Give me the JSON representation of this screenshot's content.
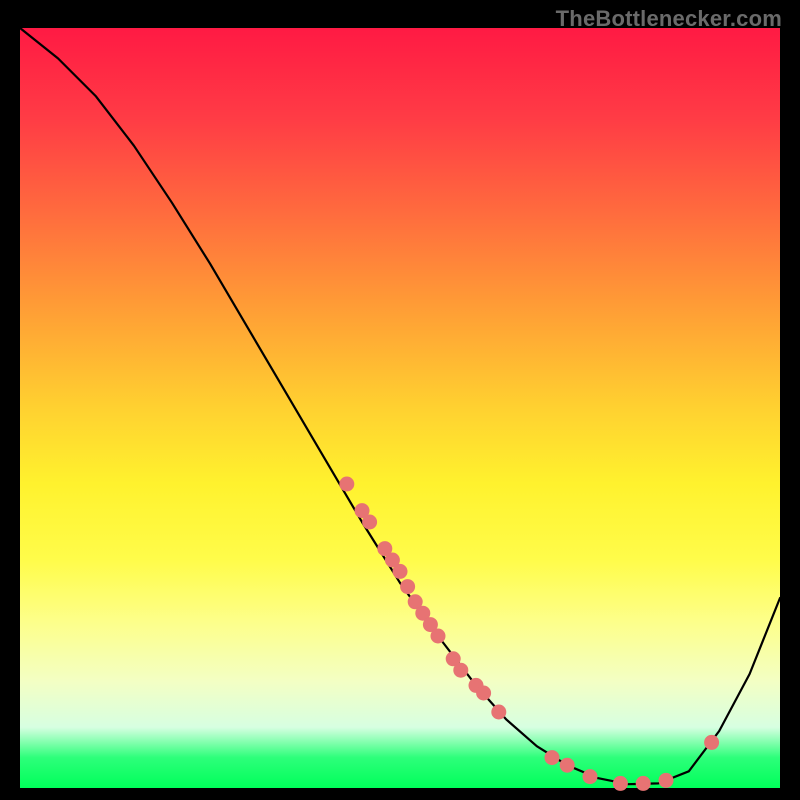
{
  "watermark": "TheBottlenecker.com",
  "chart_data": {
    "type": "line",
    "title": "",
    "xlabel": "",
    "ylabel": "",
    "xlim": [
      0,
      100
    ],
    "ylim": [
      0,
      100
    ],
    "grid": false,
    "legend": false,
    "background_gradient": [
      "#ff1a44",
      "#ffd130",
      "#fff22e",
      "#00ff5a"
    ],
    "series": [
      {
        "name": "curve",
        "x": [
          0,
          5,
          10,
          15,
          20,
          25,
          30,
          35,
          40,
          45,
          50,
          55,
          60,
          64,
          68,
          72,
          76,
          80,
          84,
          88,
          92,
          96,
          100
        ],
        "values": [
          100,
          96,
          91,
          84.5,
          77,
          69,
          60.5,
          52,
          43.5,
          35,
          27,
          20,
          13.5,
          9,
          5.5,
          3,
          1.3,
          0.5,
          0.6,
          2.2,
          7.5,
          15,
          25
        ]
      }
    ],
    "scatter_points": {
      "name": "markers",
      "x": [
        43,
        45,
        46,
        48,
        49,
        50,
        51,
        52,
        53,
        54,
        55,
        57,
        58,
        60,
        61,
        63,
        70,
        72,
        75,
        79,
        82,
        85,
        91
      ],
      "values": [
        40,
        36.5,
        35,
        31.5,
        30,
        28.5,
        26.5,
        24.5,
        23,
        21.5,
        20,
        17,
        15.5,
        13.5,
        12.5,
        10,
        4,
        3,
        1.5,
        0.6,
        0.6,
        1,
        6
      ]
    }
  }
}
